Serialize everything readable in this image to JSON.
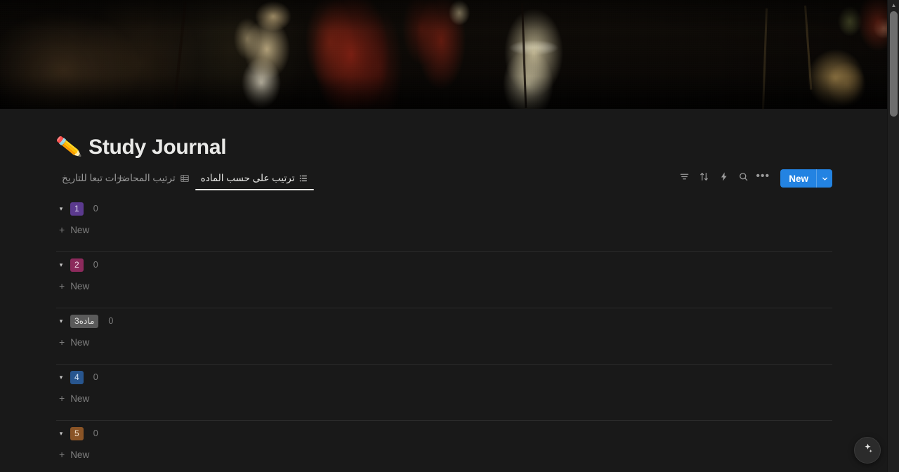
{
  "window": {
    "background": "#191919"
  },
  "cover": {
    "name": "page-cover-image",
    "description": "Rembrandt The Night Watch painting crop"
  },
  "page": {
    "emoji": "✏️",
    "title": "Study Journal"
  },
  "views": {
    "tabs": [
      {
        "label": "ترتيب على حسب الماده",
        "icon": "list-icon",
        "active": true
      },
      {
        "label": "ترتيب المحاضرات تبعا للتاريخ",
        "icon": "table-icon",
        "active": false
      }
    ],
    "add_view_label": "+"
  },
  "toolbar": {
    "filter_icon": "filter-icon",
    "sort_icon": "sort-icon",
    "automation_icon": "lightning-icon",
    "search_icon": "search-icon",
    "more_icon": "ellipsis-icon",
    "more_label": "•••",
    "new_label": "New",
    "new_chevron": "▾",
    "accent_color": "#2383e2"
  },
  "groups": [
    {
      "tag": "1",
      "count": "0",
      "tag_bg": "#5b3a8e",
      "tag_color": "#e7e2f5",
      "caret": "▾",
      "new_label": "New"
    },
    {
      "tag": "2",
      "count": "0",
      "tag_bg": "#8c2a5c",
      "tag_color": "#f4dde9",
      "caret": "▾",
      "new_label": "New"
    },
    {
      "tag": "ماده3",
      "count": "0",
      "tag_bg": "#5a5a5a",
      "tag_color": "#e3e3e1",
      "caret": "▾",
      "new_label": "New"
    },
    {
      "tag": "4",
      "count": "0",
      "tag_bg": "#28568f",
      "tag_color": "#dbe9f8",
      "caret": "▾",
      "new_label": "New"
    },
    {
      "tag": "5",
      "count": "0",
      "tag_bg": "#8a5426",
      "tag_color": "#f5e3cd",
      "caret": "▾",
      "new_label": "New"
    }
  ],
  "scrollbar": {
    "up_arrow": "▲",
    "down_arrow": "▼"
  },
  "ai_button": {
    "icon": "sparkle-icon"
  }
}
